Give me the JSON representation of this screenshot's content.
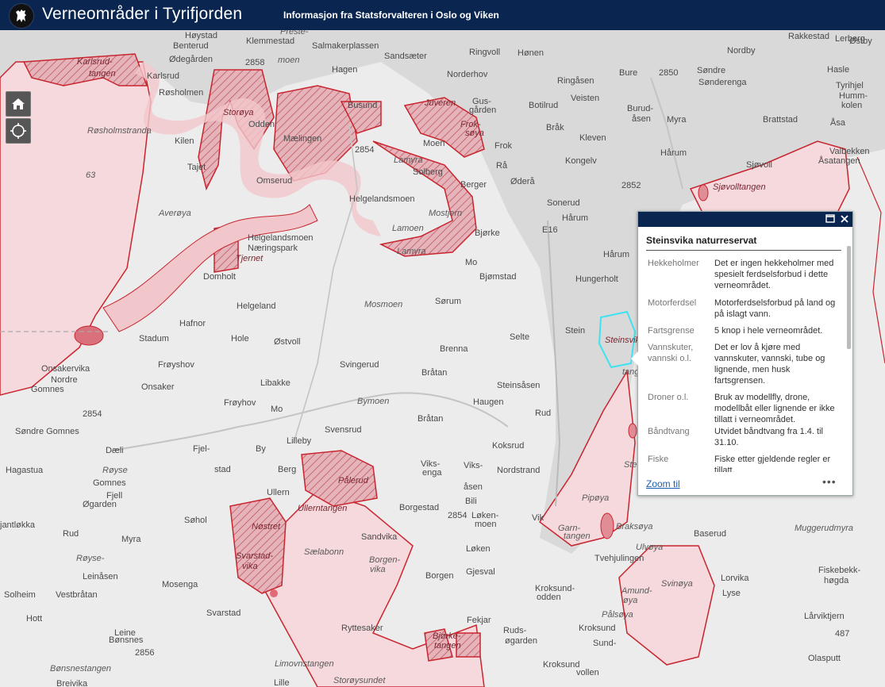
{
  "header": {
    "title": "Verneområder i Tyrifjorden",
    "subtitle": "Informasjon fra Statsforvalteren i Oslo og Viken"
  },
  "controls": {
    "home_icon": "home-icon",
    "locate_icon": "locate-icon"
  },
  "map": {
    "labels": [
      {
        "id": "hoystad",
        "text": "Høystad"
      },
      {
        "id": "klemmestad",
        "text": "Klemmestad"
      },
      {
        "id": "preste",
        "text": "Preste-"
      },
      {
        "id": "benterud",
        "text": "Benterud"
      },
      {
        "id": "odegarden",
        "text": "Ødegården"
      },
      {
        "id": "karlsrudtangen1",
        "text": "Karlsrud-"
      },
      {
        "id": "karlsrudtangen2",
        "text": "tangen"
      },
      {
        "id": "moen",
        "text": "moen"
      },
      {
        "id": "salmakerplassen",
        "text": "Salmakerplassen"
      },
      {
        "id": "sandsaeter",
        "text": "Sandsæter"
      },
      {
        "id": "ringvoll",
        "text": "Ringvoll"
      },
      {
        "id": "honen",
        "text": "Hønen"
      },
      {
        "id": "karlsrud",
        "text": "Karlsrud"
      },
      {
        "id": "hagen",
        "text": "Hagen"
      },
      {
        "id": "norderhov",
        "text": "Norderhov"
      },
      {
        "id": "rosholmen",
        "text": "Røsholmen"
      },
      {
        "id": "ringasen",
        "text": "Ringåsen"
      },
      {
        "id": "veisten",
        "text": "Veisten"
      },
      {
        "id": "busund",
        "text": "Busund"
      },
      {
        "id": "juveren",
        "text": "Juveren"
      },
      {
        "id": "gusgarden1",
        "text": "Gus-"
      },
      {
        "id": "gusgarden2",
        "text": "gården"
      },
      {
        "id": "botilrud",
        "text": "Botilrud"
      },
      {
        "id": "rosholmstranda",
        "text": "Røsholmstranda"
      },
      {
        "id": "storoya",
        "text": "Storøya"
      },
      {
        "id": "odden",
        "text": "Odden"
      },
      {
        "id": "maelingen",
        "text": "Mælingen"
      },
      {
        "id": "froksoya1",
        "text": "Frok-"
      },
      {
        "id": "froksoya2",
        "text": "søya"
      },
      {
        "id": "brak",
        "text": "Bråk"
      },
      {
        "id": "kilen",
        "text": "Kilen"
      },
      {
        "id": "moen2",
        "text": "Moen"
      },
      {
        "id": "frok",
        "text": "Frok"
      },
      {
        "id": "tajet",
        "text": "Tajet"
      },
      {
        "id": "lamyra1",
        "text": "Lamyra"
      },
      {
        "id": "ra",
        "text": "Rå"
      },
      {
        "id": "kleven",
        "text": "Kleven"
      },
      {
        "id": "kongelv",
        "text": "Kongelv"
      },
      {
        "id": "solberg",
        "text": "Solberg"
      },
      {
        "id": "num63",
        "text": "63"
      },
      {
        "id": "omseru",
        "text": "Omserud"
      },
      {
        "id": "berger",
        "text": "Berger"
      },
      {
        "id": "odera",
        "text": "Øderå"
      },
      {
        "id": "sonerud",
        "text": "Sonerud"
      },
      {
        "id": "averoya",
        "text": "Averøya"
      },
      {
        "id": "helgelandsmoen",
        "text": "Helgelandsmoen"
      },
      {
        "id": "mostjern",
        "text": "Mostjern"
      },
      {
        "id": "harum",
        "text": "Hårum"
      },
      {
        "id": "lamoen",
        "text": "Lamoen"
      },
      {
        "id": "bjorke",
        "text": "Bjørke"
      },
      {
        "id": "helgnaer1",
        "text": "Helgelandsmoen"
      },
      {
        "id": "helgnaer2",
        "text": "Næringspark"
      },
      {
        "id": "tjernet",
        "text": "Tjernet"
      },
      {
        "id": "lamyra2",
        "text": "Lamyra"
      },
      {
        "id": "mo",
        "text": "Mo"
      },
      {
        "id": "bjomstad",
        "text": "Bjømstad"
      },
      {
        "id": "domholt",
        "text": "Domholt"
      },
      {
        "id": "helgeland",
        "text": "Helgeland"
      },
      {
        "id": "mosmoen",
        "text": "Mosmoen"
      },
      {
        "id": "sorum",
        "text": "Sørum"
      },
      {
        "id": "hungerholt",
        "text": "Hungerholt"
      },
      {
        "id": "hafnor",
        "text": "Hafnor"
      },
      {
        "id": "stein",
        "text": "Stein"
      },
      {
        "id": "stadum",
        "text": "Stadum"
      },
      {
        "id": "hole",
        "text": "Hole"
      },
      {
        "id": "ostvoll",
        "text": "Østvoll"
      },
      {
        "id": "selte",
        "text": "Selte"
      },
      {
        "id": "brenna",
        "text": "Brenna"
      },
      {
        "id": "onsakervika",
        "text": "Onsakervika"
      },
      {
        "id": "froyshov",
        "text": "Frøyshov"
      },
      {
        "id": "svingerud",
        "text": "Svingerud"
      },
      {
        "id": "bratan",
        "text": "Bråtan"
      },
      {
        "id": "nordre",
        "text": "Nordre"
      },
      {
        "id": "gomnes",
        "text": "Gomnes"
      },
      {
        "id": "onsaker",
        "text": "Onsaker"
      },
      {
        "id": "libakke",
        "text": "Libakke"
      },
      {
        "id": "steinsasen",
        "text": "Steinsåsen"
      },
      {
        "id": "froyhov",
        "text": "Frøyhov"
      },
      {
        "id": "bymoen",
        "text": "Bymoen"
      },
      {
        "id": "haugen",
        "text": "Haugen"
      },
      {
        "id": "mo2",
        "text": "Mo"
      },
      {
        "id": "rud",
        "text": "Rud"
      },
      {
        "id": "bratan2",
        "text": "Bråtan"
      },
      {
        "id": "sondregomnes",
        "text": "Søndre Gomnes"
      },
      {
        "id": "svensrud",
        "text": "Svensrud"
      },
      {
        "id": "lilleby",
        "text": "Lilleby"
      },
      {
        "id": "koksrud",
        "text": "Koksrud"
      },
      {
        "id": "daeli",
        "text": "Dæli"
      },
      {
        "id": "fjel",
        "text": "Fjel-"
      },
      {
        "id": "by",
        "text": "By"
      },
      {
        "id": "hagastua",
        "text": "Hagastua"
      },
      {
        "id": "royse",
        "text": "Røyse"
      },
      {
        "id": "stad",
        "text": "stad"
      },
      {
        "id": "berg",
        "text": "Berg"
      },
      {
        "id": "viksenga",
        "text": "Viks-"
      },
      {
        "id": "viksenga2",
        "text": "enga"
      },
      {
        "id": "viksasen",
        "text": "Viks-"
      },
      {
        "id": "viksasen2",
        "text": "åsen"
      },
      {
        "id": "gomnes2",
        "text": "Gomnes"
      },
      {
        "id": "fjell",
        "text": "Fjell"
      },
      {
        "id": "ogarden",
        "text": "Øgarden"
      },
      {
        "id": "palerud",
        "text": "Pålerud"
      },
      {
        "id": "norstrand",
        "text": "Nordstrand"
      },
      {
        "id": "ullern",
        "text": "Ullern"
      },
      {
        "id": "ullerntangen",
        "text": "Ullerntangen"
      },
      {
        "id": "borgestad",
        "text": "Borgestad"
      },
      {
        "id": "bili",
        "text": "Bili"
      },
      {
        "id": "pipoya",
        "text": "Pipøya"
      },
      {
        "id": "antlokka",
        "text": "jantløkka"
      },
      {
        "id": "sohol",
        "text": "Søhol"
      },
      {
        "id": "nostret",
        "text": "Nøstret"
      },
      {
        "id": "lokenmoen1",
        "text": "Løken-"
      },
      {
        "id": "lokenmoen2",
        "text": "moen"
      },
      {
        "id": "vik",
        "text": "Vik"
      },
      {
        "id": "garntangen1",
        "text": "Garn-"
      },
      {
        "id": "garntangen2",
        "text": "tangen"
      },
      {
        "id": "braksoya",
        "text": "Braksøya"
      },
      {
        "id": "rud2",
        "text": "Rud"
      },
      {
        "id": "myra",
        "text": "Myra"
      },
      {
        "id": "svarstadvika1",
        "text": "Svarstad-"
      },
      {
        "id": "svarstadvika2",
        "text": "vika"
      },
      {
        "id": "saelabonn",
        "text": "Sælabonn"
      },
      {
        "id": "sandvika",
        "text": "Sandvika"
      },
      {
        "id": "loken",
        "text": "Løken"
      },
      {
        "id": "royse2",
        "text": "Røyse-"
      },
      {
        "id": "borgenvika1",
        "text": "Borgen-"
      },
      {
        "id": "borgenvika2",
        "text": "vika"
      },
      {
        "id": "leinasen",
        "text": "Leinåsen"
      },
      {
        "id": "tvehjulingen",
        "text": "Tvehjulingen"
      },
      {
        "id": "ulvoya",
        "text": "Ulvøya"
      },
      {
        "id": "baserud",
        "text": "Baserud"
      },
      {
        "id": "muggerudmyra",
        "text": "Muggerudmyra"
      },
      {
        "id": "mosenga",
        "text": "Mosenga"
      },
      {
        "id": "gjesval",
        "text": "Gjesval"
      },
      {
        "id": "borgen",
        "text": "Borgen"
      },
      {
        "id": "solheim",
        "text": "Solheim"
      },
      {
        "id": "vestbratan",
        "text": "Vestbråtan"
      },
      {
        "id": "amundoya",
        "text": "Amund-"
      },
      {
        "id": "amundoya2",
        "text": "øya"
      },
      {
        "id": "svinoya",
        "text": "Svinøya"
      },
      {
        "id": "lorvika",
        "text": "Lorvika"
      },
      {
        "id": "lyse",
        "text": "Lyse"
      },
      {
        "id": "fiskebekk1",
        "text": "Fiskebekk-"
      },
      {
        "id": "fiskebekk2",
        "text": "høgda"
      },
      {
        "id": "hott",
        "text": "Hott"
      },
      {
        "id": "leine",
        "text": "Leine"
      },
      {
        "id": "svarstad",
        "text": "Svarstad"
      },
      {
        "id": "kroksund",
        "text": "Kroksund-"
      },
      {
        "id": "kroksund2",
        "text": "odden"
      },
      {
        "id": "palsoya",
        "text": "Pålsøya"
      },
      {
        "id": "larviktjern",
        "text": "Lårviktjern"
      },
      {
        "id": "bonsnes",
        "text": "Bønsnes"
      },
      {
        "id": "ryttesaker",
        "text": "Ryttesaker"
      },
      {
        "id": "fekjar",
        "text": "Fekjar"
      },
      {
        "id": "rudsogarden1",
        "text": "Ruds-"
      },
      {
        "id": "rudsogarden2",
        "text": "øgarden"
      },
      {
        "id": "kroksund3",
        "text": "Kroksund"
      },
      {
        "id": "bjorketangen1",
        "text": "Bjørke-"
      },
      {
        "id": "bjorketangen2",
        "text": "tangen"
      },
      {
        "id": "sundvollen",
        "text": "Sund-"
      },
      {
        "id": "sundvollen2",
        "text": "vollen"
      },
      {
        "id": "kroksund4",
        "text": "Kroksund"
      },
      {
        "id": "olasputt",
        "text": "Olasputt"
      },
      {
        "id": "limovnstangen",
        "text": "Limovnstangen"
      },
      {
        "id": "bonsnestangen",
        "text": "Bønsnestangen"
      },
      {
        "id": "breivika",
        "text": "Breivika"
      },
      {
        "id": "lille",
        "text": "Lille"
      },
      {
        "id": "storoysundet",
        "text": "Storøysundet"
      },
      {
        "id": "rakkestad",
        "text": "Rakkestad"
      },
      {
        "id": "lerberg",
        "text": "Lerberg"
      },
      {
        "id": "ostby",
        "text": "Østby"
      },
      {
        "id": "nordby",
        "text": "Nordby"
      },
      {
        "id": "sondre1",
        "text": "Søndre"
      },
      {
        "id": "sonderenga",
        "text": "Sønderenga"
      },
      {
        "id": "bure",
        "text": "Bure"
      },
      {
        "id": "hasle",
        "text": "Hasle"
      },
      {
        "id": "tyrihjel",
        "text": "Tyrihjel"
      },
      {
        "id": "burudasen1",
        "text": "Burud-"
      },
      {
        "id": "burudasen2",
        "text": "åsen"
      },
      {
        "id": "myra2",
        "text": "Myra"
      },
      {
        "id": "humrekol1",
        "text": "Humm-"
      },
      {
        "id": "humrekol2",
        "text": "kolen"
      },
      {
        "id": "brattstad",
        "text": "Brattstad"
      },
      {
        "id": "asa",
        "text": "Åsa"
      },
      {
        "id": "harum2",
        "text": "Hårum"
      },
      {
        "id": "valbekken",
        "text": "Valbekken"
      },
      {
        "id": "asatangen",
        "text": "Åsatangen"
      },
      {
        "id": "sjoevoll",
        "text": "Sjøvoll"
      },
      {
        "id": "sjoevolltangen",
        "text": "Sjøvolltangen"
      },
      {
        "id": "harum3",
        "text": "Hårum"
      },
      {
        "id": "steinsvika_lbl",
        "text": "Steinsvika"
      },
      {
        "id": "tang",
        "text": "tang"
      },
      {
        "id": "ste",
        "text": "Ste"
      },
      {
        "id": "num2850",
        "text": "2850"
      },
      {
        "id": "num2852",
        "text": "2852"
      },
      {
        "id": "num2858",
        "text": "2858"
      },
      {
        "id": "num2854",
        "text": "2854"
      },
      {
        "id": "num2856",
        "text": "2856"
      },
      {
        "id": "num2854b",
        "text": "2854"
      },
      {
        "id": "num2854c",
        "text": "2854"
      },
      {
        "id": "e16",
        "text": "E16"
      },
      {
        "id": "num487",
        "text": "487"
      }
    ]
  },
  "popup": {
    "title": "Steinsvika naturreservat",
    "maximize_icon": "maximize-icon",
    "close_icon": "close-icon",
    "rows": [
      {
        "key": "Hekkeholmer",
        "value": "Det er ingen hekkeholmer med spesielt ferdselsforbud i dette verneområdet."
      },
      {
        "key": "Motorferdsel",
        "value": "Motorferdselsforbud på land og på islagt vann."
      },
      {
        "key": "Fartsgrense",
        "value": "5 knop i hele verneområdet."
      },
      {
        "key": "Vannskuter, vannski o.l.",
        "value": "Det er lov å kjøre med vannskuter, vannski, tube og lignende, men husk fartsgrensen."
      },
      {
        "key": "Droner o.l.",
        "value": "Bruk av modellfly, drone, modellbåt eller lignende er ikke tillatt i verneområdet."
      },
      {
        "key": "Båndtvang",
        "value": "Utvidet båndtvang fra 1.4. til 31.10."
      },
      {
        "key": "Fiske",
        "value": "Fiske etter gjeldende regler er tillatt."
      }
    ],
    "zoom_label": "Zoom til",
    "more_label": "•••"
  }
}
